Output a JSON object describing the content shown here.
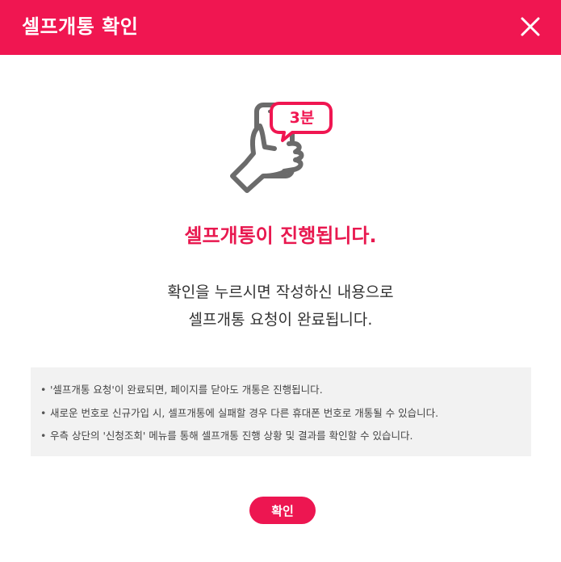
{
  "dialog": {
    "title": "셀프개통 확인",
    "close_icon": "close-icon"
  },
  "illustration": {
    "icon": "hand-phone-icon",
    "badge_text": "3분"
  },
  "headline": "셀프개통이 진행됩니다.",
  "description": {
    "line1": "확인을 누르시면 작성하신 내용으로",
    "line2": "셀프개통 요청이 완료됩니다."
  },
  "notes": [
    "'셀프개통 요청'이 완료되면, 페이지를 닫아도 개통은 진행됩니다.",
    "새로운 번호로 신규가입 시, 셀프개통에 실패할 경우 다른 휴대폰 번호로 개통될 수 있습니다.",
    "우측 상단의 '신청조회' 메뉴를 통해 셀프개통 진행 상황 및 결과를 확인할 수 있습니다."
  ],
  "confirm_button": "확인",
  "colors": {
    "accent": "#f01651",
    "note_bg": "#f2f2f2",
    "icon_gray": "#6b6b6b"
  }
}
